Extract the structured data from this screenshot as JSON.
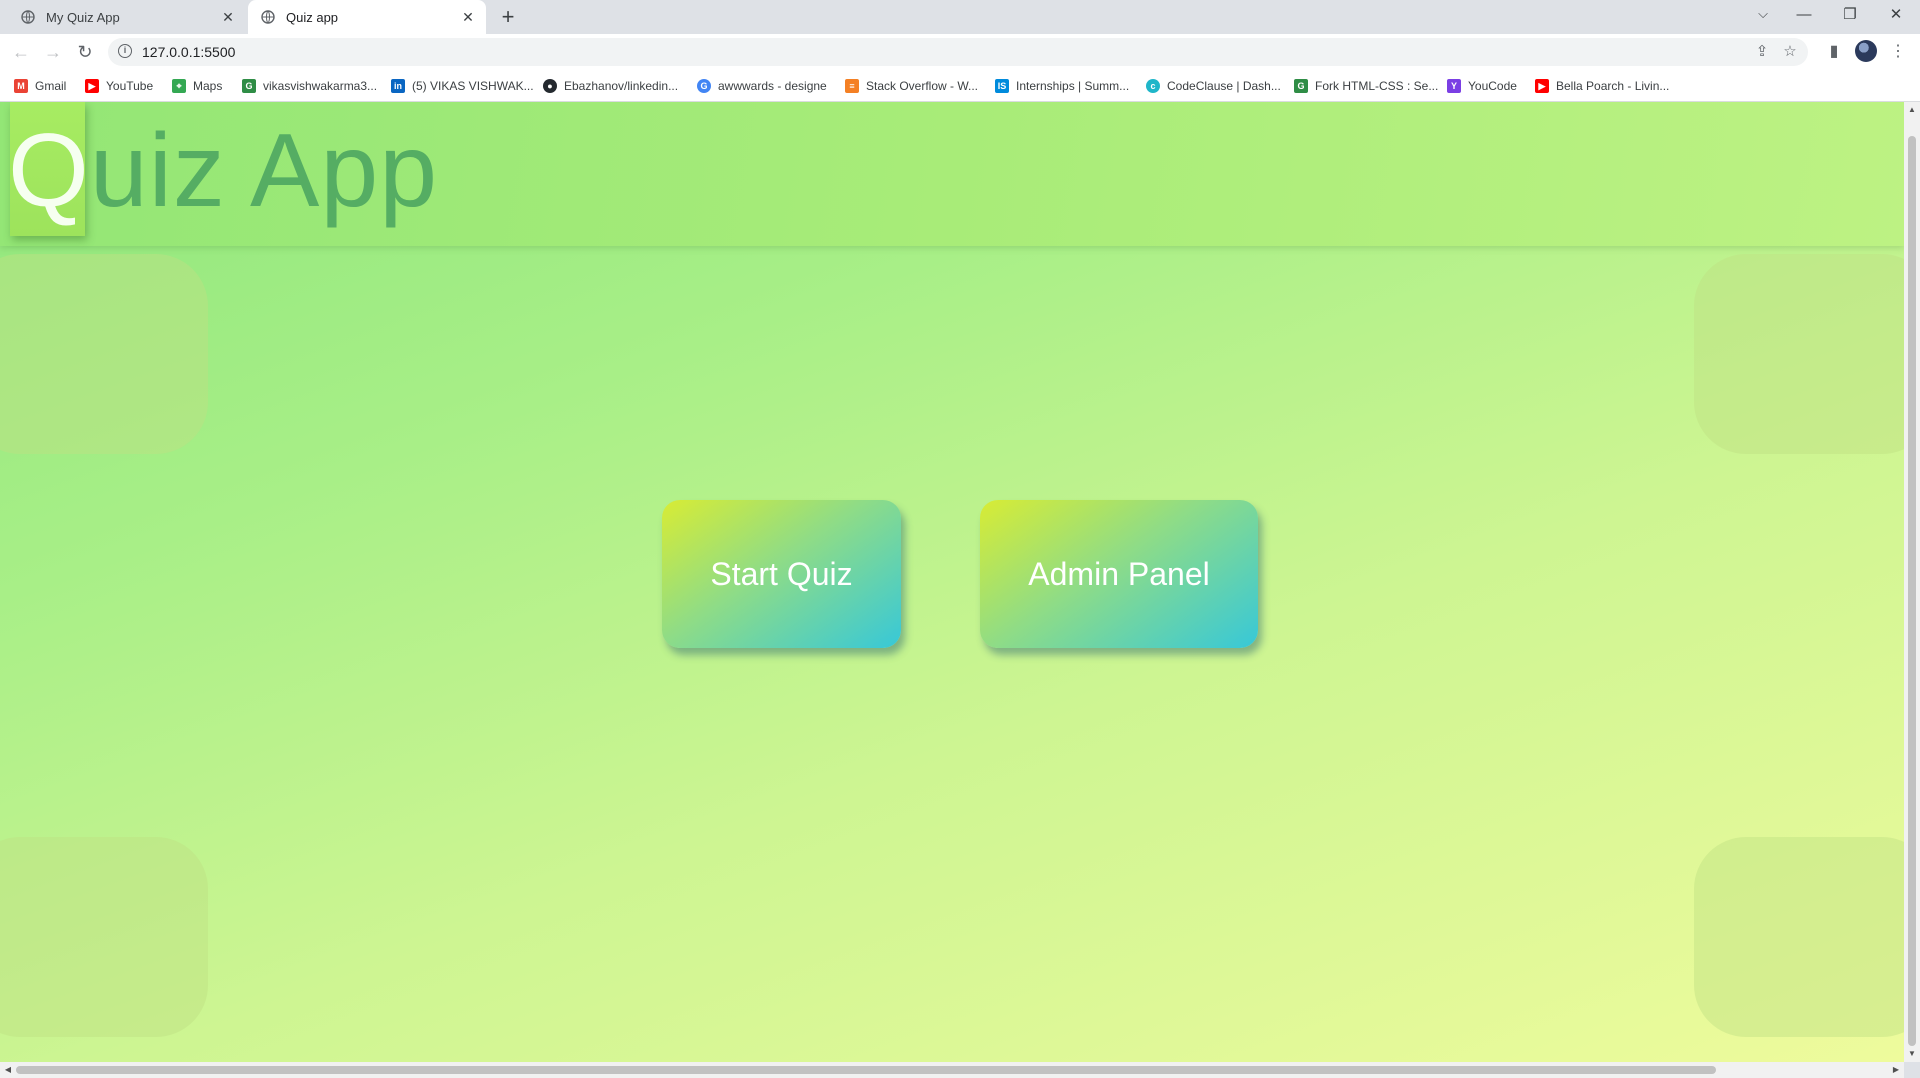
{
  "browser": {
    "tabs": [
      {
        "title": "My Quiz App",
        "active": false
      },
      {
        "title": "Quiz app",
        "active": true
      }
    ],
    "new_tab": "+",
    "close": "✕",
    "url": "127.0.0.1:5500",
    "bookmarks": [
      {
        "label": "Gmail",
        "icon": "gmail-icon",
        "color": "#ea4335"
      },
      {
        "label": "YouTube",
        "icon": "youtube-icon",
        "color": "#ff0000"
      },
      {
        "label": "Maps",
        "icon": "maps-icon",
        "color": "#34a853"
      },
      {
        "label": "vikasvishwakarma3...",
        "icon": "gfg-icon",
        "color": "#2f8d46"
      },
      {
        "label": "(5) VIKAS VISHWAK...",
        "icon": "linkedin-icon",
        "color": "#0a66c2"
      },
      {
        "label": "Ebazhanov/linkedin...",
        "icon": "github-icon",
        "color": "#24292f"
      },
      {
        "label": "awwwards - designe",
        "icon": "google-icon",
        "color": "#4285f4"
      },
      {
        "label": "Stack Overflow - W...",
        "icon": "stackoverflow-icon",
        "color": "#f48024"
      },
      {
        "label": "Internships | Summ...",
        "icon": "internshala-icon",
        "color": "#008bdc"
      },
      {
        "label": "CodeClause | Dash...",
        "icon": "codeclause-icon",
        "color": "#1fb6c9"
      },
      {
        "label": "Fork HTML-CSS : Se...",
        "icon": "gfg-icon",
        "color": "#2f8d46"
      },
      {
        "label": "YouCode",
        "icon": "youcode-icon",
        "color": "#7b3fe4"
      },
      {
        "label": "Bella Poarch - Livin...",
        "icon": "youtube-icon",
        "color": "#ff0000"
      }
    ]
  },
  "page": {
    "title_first_letter": "Q",
    "title_rest": "uiz App",
    "buttons": {
      "start_quiz": "Start Quiz",
      "admin_panel": "Admin Panel"
    }
  },
  "colors": {
    "title_text": "#55ad63",
    "button_gradient": [
      "#d8ec34",
      "#8fdc86",
      "#37c8d8"
    ],
    "background": [
      "#8fe67c",
      "#eefb9c"
    ]
  }
}
